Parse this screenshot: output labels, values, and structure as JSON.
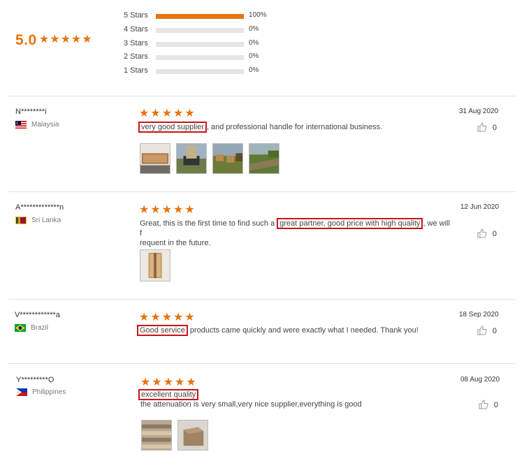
{
  "rating": {
    "score": "5.0",
    "stars": "★★★★★",
    "distribution": [
      {
        "label": "5 Stars",
        "percent": 100,
        "pct_text": "100%"
      },
      {
        "label": "4 Stars",
        "percent": 0,
        "pct_text": "0%"
      },
      {
        "label": "3 Stars",
        "percent": 0,
        "pct_text": "0%"
      },
      {
        "label": "2 Stars",
        "percent": 0,
        "pct_text": "0%"
      },
      {
        "label": "1 Stars",
        "percent": 0,
        "pct_text": "0%"
      }
    ]
  },
  "colors": {
    "accent": "#e8730f",
    "highlight_box": "#c8141a"
  },
  "reviews": [
    {
      "name": "N********i",
      "country": "Malaysia",
      "stars": "★★★★★",
      "date": "31 Aug 2020",
      "text_hl": "very good supplier",
      "text_rest": ", and professional handle for international business.",
      "likes": "0",
      "like_icon": "thumbs-up-icon"
    },
    {
      "name": "A*************n",
      "country": "Sri Lanka",
      "stars": "★★★★★",
      "date": "12 Jun 2020",
      "text_pre": "Great, this is the first time to find such a ",
      "text_hl": "great partner, good price with high quality",
      "text_rest": ", we will f",
      "text_line2": "requent in the future.",
      "likes": "0",
      "like_icon": "thumbs-up-icon"
    },
    {
      "name": "V************a",
      "country": "Brazil",
      "stars": "★★★★★",
      "date": "18 Sep 2020",
      "text_hl": "Good service",
      "text_rest": " products came quickly and were exactly what I needed. Thank you!",
      "likes": "0",
      "like_icon": "thumbs-up-icon"
    },
    {
      "name": "Y*********O",
      "country": "Philippines",
      "stars": "★★★★★",
      "date": "08 Aug 2020",
      "text_hl": "excellent quality",
      "text_line2": "the attenuation is very small,very nice supplier,everything is good",
      "likes": "0",
      "like_icon": "thumbs-up-icon"
    }
  ]
}
